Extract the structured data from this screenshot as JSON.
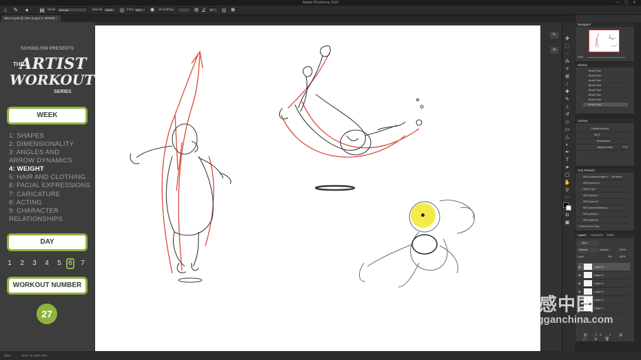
{
  "app": {
    "title": "Adobe Photoshop 2020",
    "window_controls": [
      "—",
      "▢",
      "✕"
    ]
  },
  "options_bar": {
    "mode_label": "Mode:",
    "mode_value": "Normal",
    "opacity_label": "Opacity:",
    "opacity_value": "100%",
    "flow_label": "Flow:",
    "flow_value": "50%",
    "smoothing_label": "Smoothing:",
    "smoothing_value": "",
    "angle_value": "0°"
  },
  "document": {
    "tab_title": "WK4-4.psd @ 33% (Layer 6, RGB/8) *",
    "zoom": "33%",
    "doc_size": "Doc: 24.1M/1.03G"
  },
  "tutorial": {
    "presents_line": "SCHOOLISM PRESENTS",
    "logo_the": "THE",
    "logo_artist": "ARTIST",
    "logo_workout": "WORKOUT",
    "logo_series": "SERIES",
    "week_label": "WEEK",
    "weeks": [
      {
        "text": "1:  SHAPES",
        "active": false
      },
      {
        "text": "2:  DIMENSIONALITY",
        "active": false
      },
      {
        "text": "3:  ANGLES AND",
        "active": false
      },
      {
        "text": "     ARROW DYNAMICS",
        "active": false
      },
      {
        "text": "4:  WEIGHT",
        "active": true
      },
      {
        "text": "5:  HAIR AND CLOTHING",
        "active": false
      },
      {
        "text": "6:  FACIAL EXPRESSIONS",
        "active": false
      },
      {
        "text": "7:  CARICATURE",
        "active": false
      },
      {
        "text": "8:  ACTING",
        "active": false
      },
      {
        "text": "9:  CHARACTER",
        "active": false
      },
      {
        "text": "     RELATIONSHIPS",
        "active": false
      }
    ],
    "day_label": "DAY",
    "days": [
      "1",
      "2",
      "3",
      "4",
      "5",
      "6",
      "7"
    ],
    "active_day": "6",
    "workout_label": "WORKOUT NUMBER",
    "workout_number": "27",
    "accent_color": "#8db43a"
  },
  "panels": {
    "navigator": {
      "title": "Navigator",
      "zoom": "33%"
    },
    "history": {
      "title": "History",
      "items": [
        "Brush Tool",
        "Brush Tool",
        "Brush Tool",
        "Brush Tool",
        "Brush Tool",
        "Brush Tool",
        "Brush Tool",
        "Brush Tool"
      ]
    },
    "actions": {
      "title": "Actions",
      "items": [
        "Default Actions",
        "Set 1",
        "fill selection",
        "clipping mask"
      ],
      "shortcut": "F10"
    },
    "tool_presets": {
      "title": "Tool Presets",
      "items": [
        "SKS a brush/eraser 3 ... 08 brush",
        "SKS pencil 14",
        "SKS 4 dj 5",
        "SKS pencil 4",
        "SKS pencil 8",
        "SKS pencil thinkery 1",
        "SKS pencil 9",
        "SKS pencil 6"
      ],
      "footer": "Current Tool Only"
    },
    "layers": {
      "tabs": [
        "Layers",
        "Channels",
        "Paths"
      ],
      "filter_label": "Kind",
      "blend_mode": "Normal",
      "opacity_label": "Opacity:",
      "opacity_value": "100%",
      "lock_label": "Lock:",
      "fill_label": "Fill:",
      "fill_value": "100%",
      "items": [
        {
          "name": "Layer 6",
          "active": true
        },
        {
          "name": "Layer 5",
          "active": false
        },
        {
          "name": "Layer 4",
          "active": false
        },
        {
          "name": "Layer 3",
          "active": false
        },
        {
          "name": "Layer 2",
          "active": false
        },
        {
          "name": "Layer 1",
          "active": false
        }
      ]
    }
  },
  "watermark": {
    "chinese": "灵感中国",
    "english": "lingganchina.com"
  }
}
